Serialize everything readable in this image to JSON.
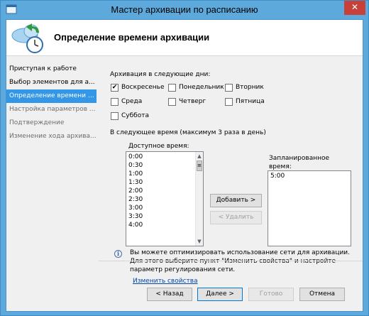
{
  "window": {
    "title": "Мастер архивации по расписанию",
    "close_glyph": "✕"
  },
  "header": {
    "title": "Определение времени архивации",
    "icon": "backup-clock-icon"
  },
  "nav": {
    "items": [
      {
        "label": "Приступая к работе",
        "state": "normal"
      },
      {
        "label": "Выбор элементов для а...",
        "state": "normal"
      },
      {
        "label": "Определение времени а...",
        "state": "active"
      },
      {
        "label": "Настройка параметров ...",
        "state": "disabled"
      },
      {
        "label": "Подтверждение",
        "state": "disabled"
      },
      {
        "label": "Изменение хода архива...",
        "state": "disabled"
      }
    ]
  },
  "days": {
    "label": "Архивация в следующие дни:",
    "items": [
      {
        "label": "Воскресенье",
        "checked": true,
        "mark": "✔"
      },
      {
        "label": "Понедельник",
        "checked": false,
        "mark": ""
      },
      {
        "label": "Вторник",
        "checked": false,
        "mark": ""
      },
      {
        "label": "Среда",
        "checked": false,
        "mark": ""
      },
      {
        "label": "Четверг",
        "checked": false,
        "mark": ""
      },
      {
        "label": "Пятница",
        "checked": false,
        "mark": ""
      },
      {
        "label": "Суббота",
        "checked": false,
        "mark": ""
      }
    ]
  },
  "times": {
    "label": "В следующее время (максимум 3 раза в день)",
    "available_label": "Доступное время:",
    "available": [
      "0:00",
      "0:30",
      "1:00",
      "1:30",
      "2:00",
      "2:30",
      "3:00",
      "3:30",
      "4:00"
    ],
    "scheduled_label_line1": "Запланированное",
    "scheduled_label_line2": "время:",
    "scheduled": [
      "5:00"
    ],
    "add_button": "Добавить >",
    "remove_button": "< Удалить"
  },
  "info": {
    "icon_glyph": "i",
    "text": "Вы можете оптимизировать использование сети для архивации. Для этого выберите пункт \"Изменить свойства\" и настройте параметр регулирования сети.",
    "link": "Изменить свойства"
  },
  "footer": {
    "back": "< Назад",
    "next": "Далее >",
    "finish": "Готово",
    "cancel": "Отмена"
  }
}
